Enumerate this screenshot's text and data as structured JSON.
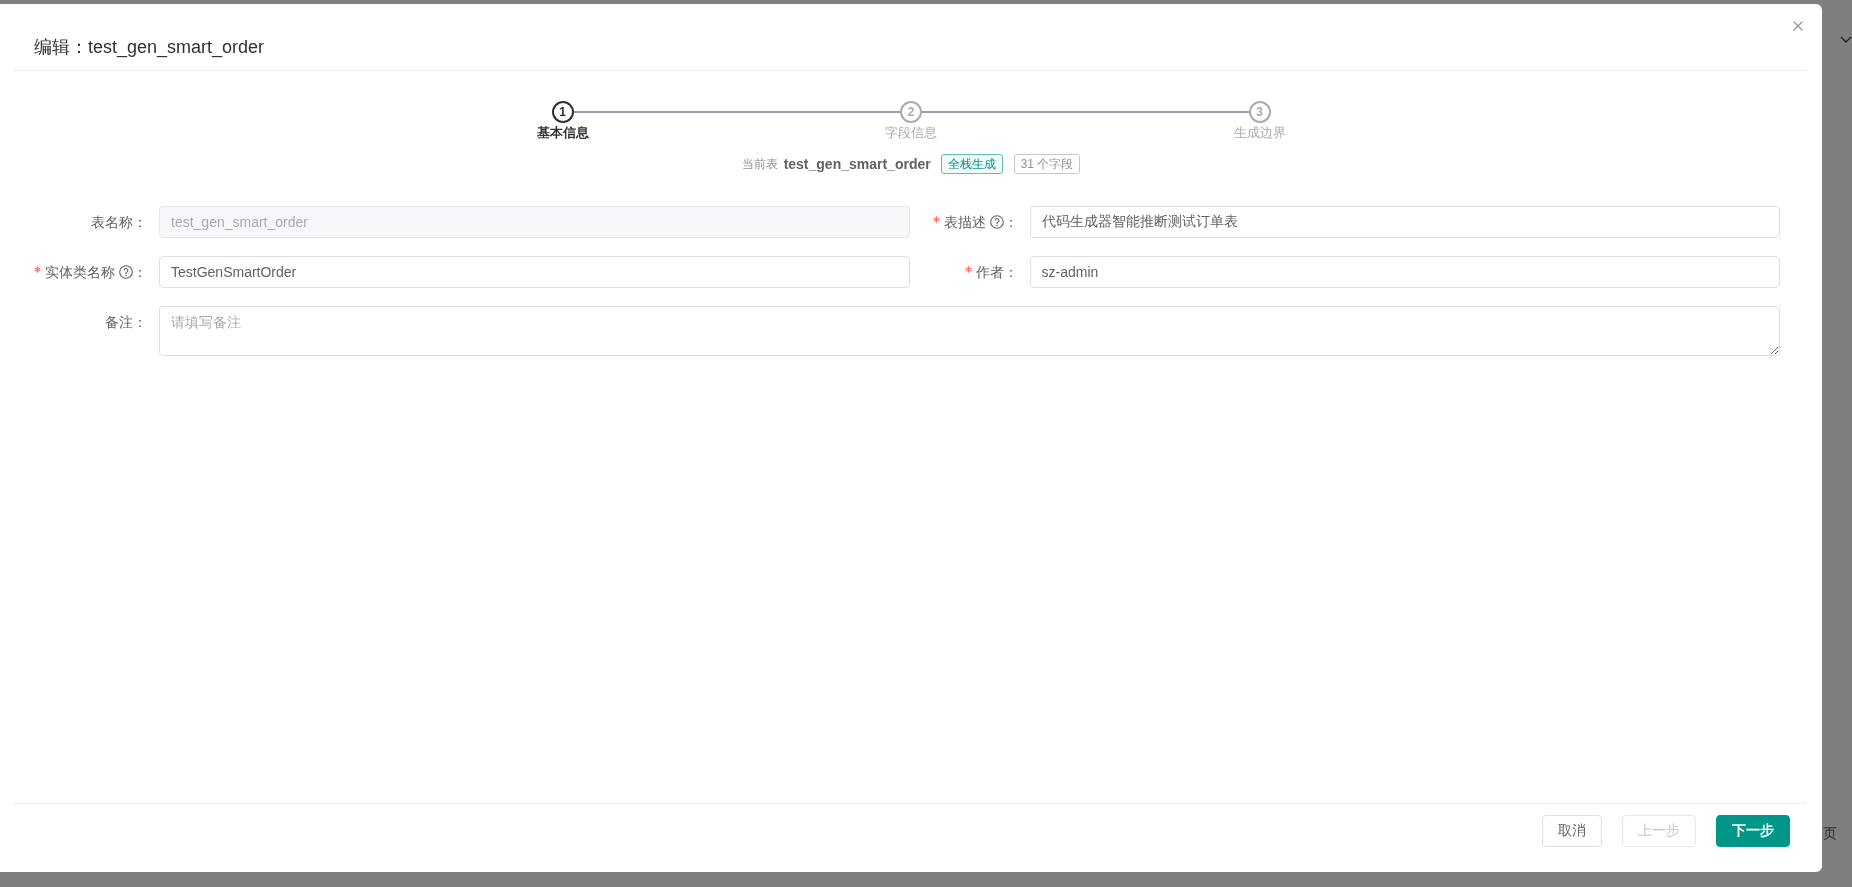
{
  "dialog": {
    "title": "编辑：test_gen_smart_order"
  },
  "steps": [
    {
      "number": "1",
      "label": "基本信息",
      "active": true
    },
    {
      "number": "2",
      "label": "字段信息",
      "active": false
    },
    {
      "number": "3",
      "label": "生成边界",
      "active": false
    }
  ],
  "current_table": {
    "caption": "当前表",
    "name": "test_gen_smart_order",
    "tags": [
      {
        "text": "全栈生成",
        "kind": "primary"
      },
      {
        "text": "31 个字段",
        "kind": "plain"
      }
    ]
  },
  "form": {
    "fields": [
      {
        "kind": "input",
        "label": "表名称：",
        "help": false,
        "required": false,
        "value": "test_gen_smart_order",
        "disabled": true
      },
      {
        "kind": "input",
        "label": "表描述",
        "help": true,
        "label_end": "：",
        "required": true,
        "value": "代码生成器智能推断测试订单表",
        "disabled": false
      },
      {
        "kind": "input",
        "label": "实体类名称",
        "help": true,
        "label_end": "：",
        "required": true,
        "value": "TestGenSmartOrder",
        "disabled": false
      },
      {
        "kind": "input",
        "label": "作者：",
        "help": false,
        "required": true,
        "value": "sz-admin",
        "disabled": false
      },
      {
        "kind": "textarea",
        "label": "备注：",
        "help": false,
        "required": false,
        "placeholder": "请填写备注",
        "disabled": false
      }
    ]
  },
  "footer": {
    "buttons": [
      {
        "label": "取消",
        "kind": "default",
        "disabled": false
      },
      {
        "label": "上一步",
        "kind": "default",
        "disabled": true
      },
      {
        "label": "下一步",
        "kind": "primary",
        "disabled": false
      }
    ]
  },
  "background": {
    "text_fragment": "页"
  }
}
